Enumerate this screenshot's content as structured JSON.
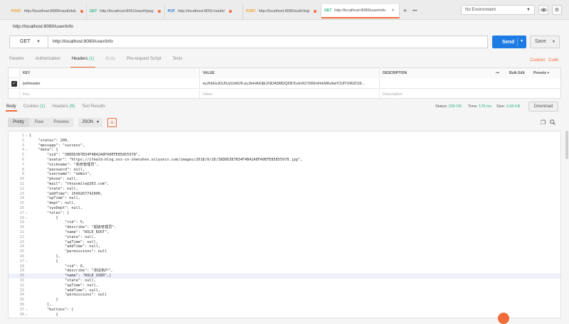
{
  "tabs": [
    {
      "method": "POST",
      "url": "http://localhost:8989/oauth/tok",
      "unsaved": true
    },
    {
      "method": "GET",
      "url": "http://localhost:8091/oauth/pag",
      "unsaved": true
    },
    {
      "method": "PUT",
      "url": "http://localhost:8091/oauth/",
      "unsaved": true
    },
    {
      "method": "POST",
      "url": "http://localhost:8080/auth/logi",
      "unsaved": true
    },
    {
      "method": "GET",
      "url": "http://localhost:8080/user/info",
      "unsaved": false
    }
  ],
  "tab_plus": "+",
  "tab_more": "•••",
  "environment": "No Environment",
  "request": {
    "title": "http://localhost:8080/user/info",
    "method": "GET",
    "url": "http://localhost:8080/user/info",
    "send_label": "Send",
    "save_label": "Save"
  },
  "req_tabs": {
    "params": "Params",
    "authorization": "Authorization",
    "headers": "Headers",
    "headers_count": "(1)",
    "body": "Body",
    "prerequest": "Pre-request Script",
    "tests": "Tests",
    "cookies": "Cookies",
    "code": "Code"
  },
  "headers_table": {
    "col_key": "KEY",
    "col_value": "VALUE",
    "col_desc": "DESCRIPTION",
    "more": "•••",
    "bulk_edit": "Bulk Edit",
    "presets": "Presets",
    "row_key": "jwtHeader",
    "row_value": "eyJhbGciOiJIUzUxMJ9.eyJleHAiOjE1NDA5MDQ5NTcsInN1YiI6ImFkbWluIiwiY3JlYXRlZCI6...",
    "ph_key": "Key",
    "ph_value": "Value",
    "ph_desc": "Description"
  },
  "response": {
    "body": "Body",
    "cookies": "Cookies",
    "cookies_count": "(1)",
    "headers": "Headers",
    "headers_count": "(9)",
    "tests": "Test Results",
    "status_label": "Status:",
    "status": "200 OK",
    "time_label": "Time:",
    "time": "178 ms",
    "size_label": "Size:",
    "size": "3.66 KB",
    "download": "Download"
  },
  "body_toolbar": {
    "pretty": "Pretty",
    "raw": "Raw",
    "preview": "Preview",
    "format": "JSON"
  },
  "code_lines": [
    {
      "n": "1",
      "f": "▾",
      "t": "{"
    },
    {
      "n": "2",
      "f": "",
      "t": "    \"status\": 200,"
    },
    {
      "n": "3",
      "f": "",
      "t": "    \"message\": \"success\","
    },
    {
      "n": "4",
      "f": "▾",
      "t": "    \"data\": {"
    },
    {
      "n": "5",
      "f": "",
      "t": "        \"uid\": \"38DDD387B34F4B42A8FA0EFE85855978\","
    },
    {
      "n": "6",
      "f": "",
      "t": "        \"avatar\": \"https://ifeald-blog.oss-cn-shenzhen.aliyuncs.com/images/2018/9/28/38DDD387B34F4B42A8FA0EFE85855978.jpg\","
    },
    {
      "n": "7",
      "f": "",
      "t": "        \"nickname\": \"系统管理员\","
    },
    {
      "n": "8",
      "f": "",
      "t": "        \"password\": null,"
    },
    {
      "n": "9",
      "f": "",
      "t": "        \"username\": \"admin\","
    },
    {
      "n": "10",
      "f": "",
      "t": "        \"phone\": null,"
    },
    {
      "n": "11",
      "f": "",
      "t": "        \"mail\": \"thousmile@163.com\","
    },
    {
      "n": "12",
      "f": "",
      "t": "        \"state\": null,"
    },
    {
      "n": "13",
      "f": "",
      "t": "        \"addTime\": 1540267742000,"
    },
    {
      "n": "14",
      "f": "",
      "t": "        \"upTime\": null,"
    },
    {
      "n": "15",
      "f": "",
      "t": "        \"dept\": null,"
    },
    {
      "n": "16",
      "f": "",
      "t": "        \"sysDept\": null,"
    },
    {
      "n": "17",
      "f": "▾",
      "t": "        \"roles\": ["
    },
    {
      "n": "18",
      "f": "▾",
      "t": "            {"
    },
    {
      "n": "19",
      "f": "",
      "t": "                \"rid\": 5,"
    },
    {
      "n": "20",
      "f": "",
      "t": "                \"describe\": \"超级管理员\","
    },
    {
      "n": "21",
      "f": "",
      "t": "                \"name\": \"ROLE_ROOT\","
    },
    {
      "n": "22",
      "f": "",
      "t": "                \"state\": null,"
    },
    {
      "n": "23",
      "f": "",
      "t": "                \"upTime\": null,"
    },
    {
      "n": "24",
      "f": "",
      "t": "                \"addTime\": null,"
    },
    {
      "n": "25",
      "f": "",
      "t": "                \"permissions\": null"
    },
    {
      "n": "26",
      "f": "",
      "t": "            },"
    },
    {
      "n": "27",
      "f": "▾",
      "t": "            {"
    },
    {
      "n": "28",
      "f": "",
      "t": "                \"rid\": 6,"
    },
    {
      "n": "29",
      "f": "",
      "t": "                \"describe\": \"测试用户\","
    },
    {
      "n": "30",
      "f": "",
      "t": "                \"name\": \"ROLE_USER\",|"
    },
    {
      "n": "31",
      "f": "",
      "t": "                \"state\": null,"
    },
    {
      "n": "32",
      "f": "",
      "t": "                \"upTime\": null,"
    },
    {
      "n": "33",
      "f": "",
      "t": "                \"addTime\": null,"
    },
    {
      "n": "34",
      "f": "",
      "t": "                \"permissions\": null"
    },
    {
      "n": "35",
      "f": "",
      "t": "            }"
    },
    {
      "n": "36",
      "f": "",
      "t": "        ],"
    },
    {
      "n": "37",
      "f": "▾",
      "t": "        \"buttons\": ["
    },
    {
      "n": "38",
      "f": "▾",
      "t": "            {"
    }
  ],
  "highlight_line": 30,
  "colors": {
    "accent": "#f26b3a",
    "send": "#1d7ce3",
    "ok": "#26b47f"
  }
}
